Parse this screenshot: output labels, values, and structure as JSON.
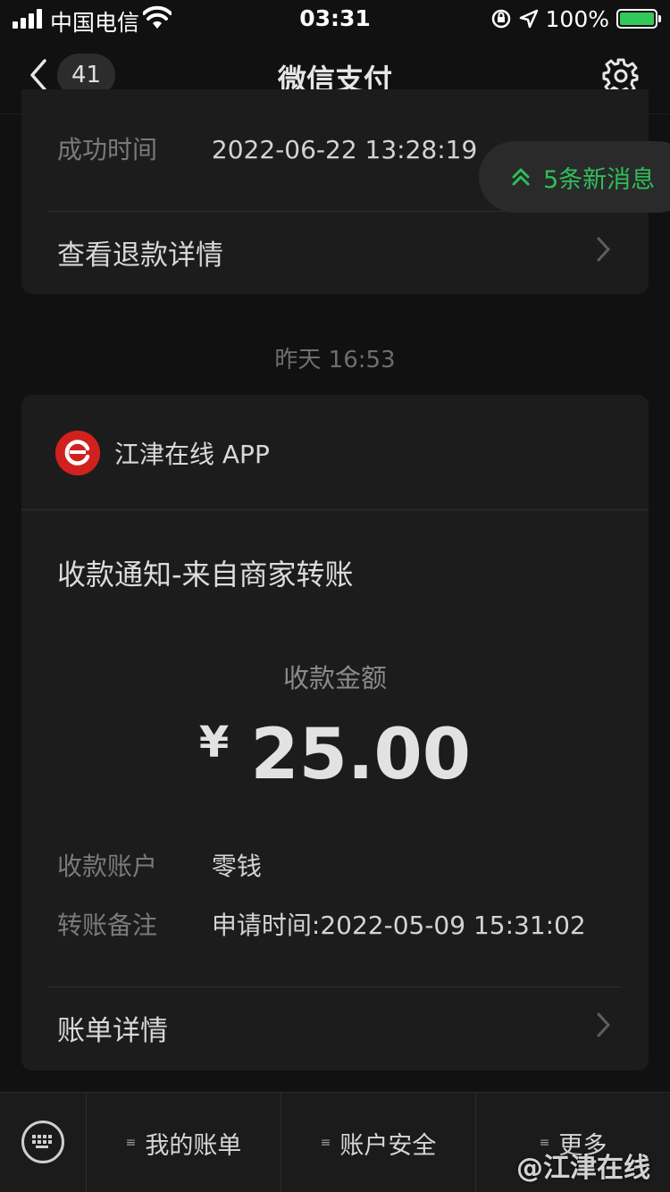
{
  "status_bar": {
    "carrier": "中国电信",
    "time": "03:31",
    "battery": "100%"
  },
  "nav": {
    "back_count": "41",
    "title": "微信支付"
  },
  "refund_card": {
    "success_time_label": "成功时间",
    "success_time_value": "2022-06-22 13:28:19",
    "refund_detail_link": "查看退款详情"
  },
  "new_messages": "5条新消息",
  "timestamp": "昨天 16:53",
  "payment_card": {
    "merchant_name": "江津在线 APP",
    "logo_text": "江津在线",
    "notice_title": "收款通知-来自商家转账",
    "amount_label": "收款金额",
    "currency": "¥",
    "amount": "25.00",
    "account_label": "收款账户",
    "account_value": "零钱",
    "remark_label": "转账备注",
    "remark_value": "申请时间:2022-05-09 15:31:02",
    "bill_detail_link": "账单详情"
  },
  "bottom_menu": {
    "items": [
      "我的账单",
      "账户安全",
      "更多"
    ]
  },
  "watermark": "@江津在线",
  "colors": {
    "background": "#111111",
    "card": "#1c1c1c",
    "accent_green": "#2fbe5a",
    "logo_red": "#d0211f"
  }
}
